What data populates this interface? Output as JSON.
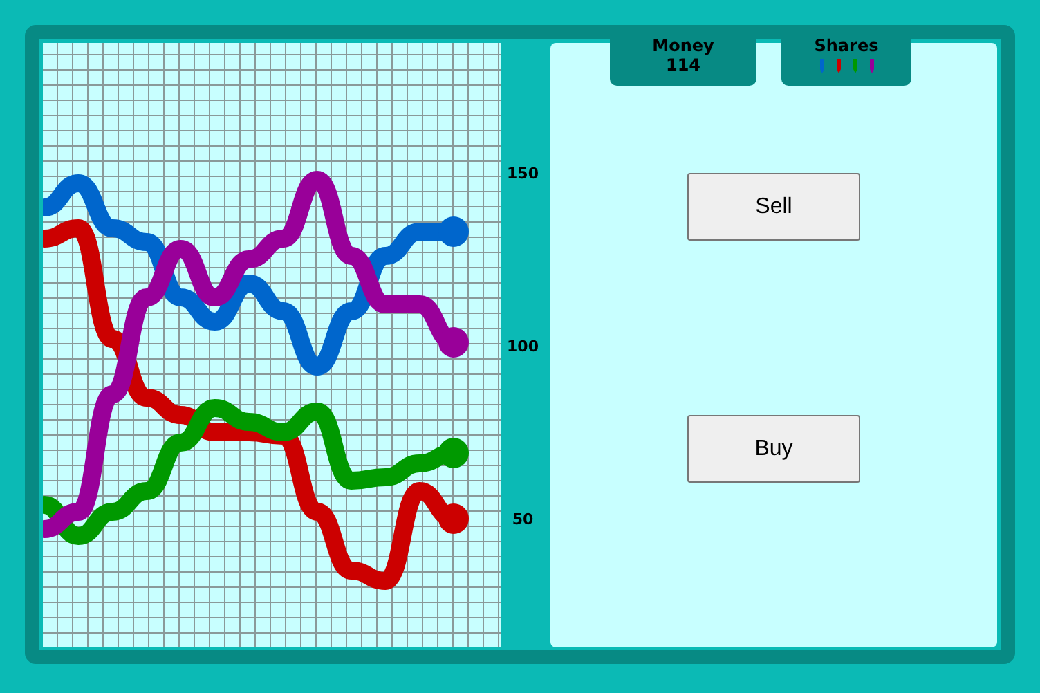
{
  "chart_data": {
    "type": "line",
    "grid": true,
    "ylim": [
      12.8,
      187.6
    ],
    "yticks": [
      50,
      100,
      150
    ],
    "series": [
      {
        "color": "#0066cc",
        "values": [
          140,
          147,
          134,
          130,
          114,
          107,
          118,
          110,
          94,
          110,
          126,
          133,
          133
        ]
      },
      {
        "color": "#cc0000",
        "values": [
          131,
          134,
          102,
          85,
          80,
          75,
          75,
          74,
          52,
          35,
          32,
          58,
          50
        ]
      },
      {
        "color": "#009900",
        "values": [
          54,
          45,
          52,
          58,
          72,
          82,
          78,
          75,
          81,
          61,
          62,
          66,
          69
        ]
      },
      {
        "color": "#990099",
        "values": [
          47,
          52,
          86,
          114,
          128,
          114,
          125,
          131,
          148,
          126,
          112,
          112,
          101
        ]
      }
    ]
  },
  "money": {
    "label": "Money",
    "value": "114"
  },
  "shares": {
    "label": "Shares",
    "holdings": [
      {
        "color": "#0066cc"
      },
      {
        "color": "#cc0000"
      },
      {
        "color": "#009900"
      },
      {
        "color": "#990099"
      }
    ]
  },
  "buttons": [
    {
      "label": "Sell"
    },
    {
      "label": "Buy"
    }
  ]
}
